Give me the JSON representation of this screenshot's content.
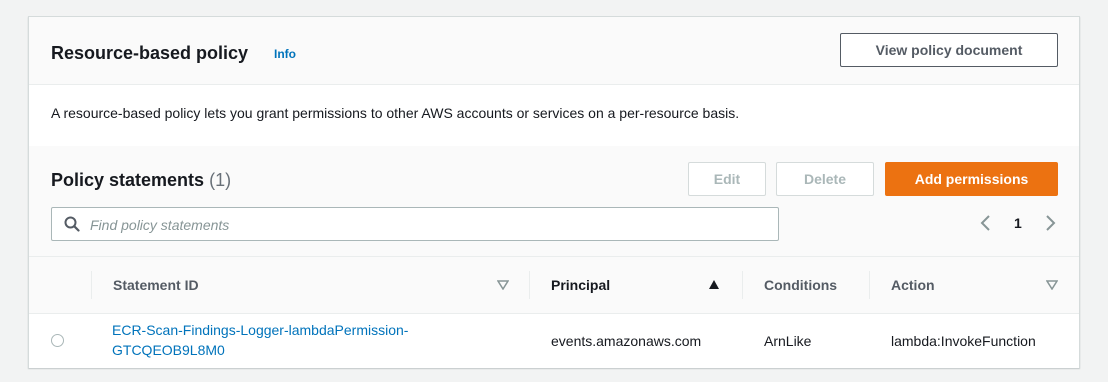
{
  "header": {
    "title": "Resource-based policy",
    "info_label": "Info",
    "view_policy_label": "View policy document"
  },
  "description": "A resource-based policy lets you grant permissions to other AWS accounts or services on a per-resource basis.",
  "statements": {
    "title": "Policy statements",
    "count": "(1)",
    "edit_label": "Edit",
    "delete_label": "Delete",
    "add_label": "Add permissions",
    "search_placeholder": "Find policy statements",
    "page": "1"
  },
  "table": {
    "columns": [
      "Statement ID",
      "Principal",
      "Conditions",
      "Action"
    ],
    "rows": [
      {
        "statement_id_line1": "ECR-Scan-Findings-Logger-lambdaPermission-",
        "statement_id_line2": "GTCQEOB9L8M0",
        "principal": "events.amazonaws.com",
        "conditions": "ArnLike",
        "action": "lambda:InvokeFunction"
      }
    ]
  },
  "colors": {
    "primary": "#ec7211",
    "link": "#0073bb"
  }
}
